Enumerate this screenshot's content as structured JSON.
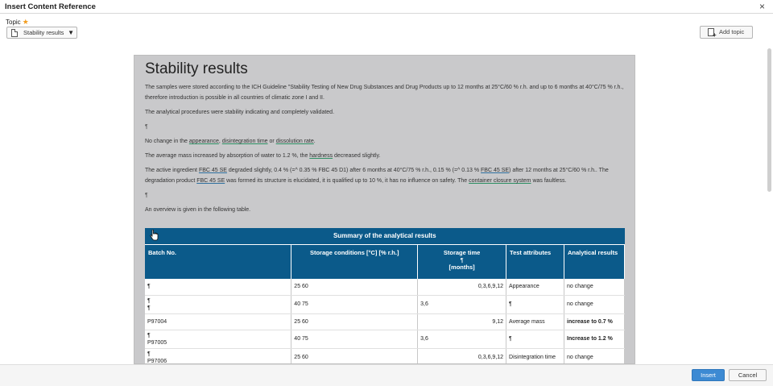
{
  "dialog": {
    "title": "Insert Content Reference",
    "close_glyph": "×"
  },
  "topic": {
    "label": "Topic",
    "required_mark": "★",
    "selected": "Stability results",
    "caret": "▼"
  },
  "add_topic_label": "Add topic",
  "document": {
    "title": "Stability results",
    "p1": "The samples were stored according to the ICH Guideline \"Stability Testing of New Drug Substances and Drug Products up to 12 months at 25°C/60 % r.h. and up to 6 months at 40°C/75 % r.h., therefore introduction is possible in all countries of climatic zone I and II.",
    "p2": "The analytical procedures were stability indicating and completely validated.",
    "pilcrow": "¶",
    "p3_pre": "No change in the ",
    "p3_l1": "appearance",
    "p3_sep1": ", ",
    "p3_l2": "disintegration time",
    "p3_sep2": " or ",
    "p3_l3": "dissolution rate",
    "p3_end": ".",
    "p4_pre": "The average mass increased by absorption of water to 1.2 %, the ",
    "p4_l1": "hardness",
    "p4_end": " decreased slightly.",
    "p5_a": "The active ingredient ",
    "p5_l1": "FBC 45 SE",
    "p5_b": " degraded slightly, 0.4 % (=^ 0.35 % FBC 45 D1) after 6 months at 40°C/75 % r.h., 0.15 % (=^ 0.13 % ",
    "p5_l2": "FBC 45 SE",
    "p5_c": ") after 12 months at 25°C/60 % r.h.. The degradation product ",
    "p5_l3": "FBC 45 SE",
    "p5_d": " was formed its structure is elucidated, it is qualified up to 10 %, it has no influence on safety. The ",
    "p5_l4": "container closure system",
    "p5_e": " was faultless.",
    "p6": "An overview is given in the following table."
  },
  "table": {
    "caption": "Summary of the analytical results",
    "headers": {
      "batch": "Batch No.",
      "storage": "Storage conditions [°C] [% r.h.]",
      "time": "Storage time",
      "time_mark": "¶",
      "time_unit": "[months]",
      "attr": "Test attributes",
      "result": "Analytical results"
    },
    "rows": [
      {
        "batch": "¶",
        "cond": "25 60",
        "time": "",
        "months": "0,3,6,9,12",
        "attr": "Appearance",
        "result": "no change"
      },
      {
        "batch": "¶\n¶",
        "cond": "40 75",
        "time": "3,6",
        "months": "",
        "attr": "¶",
        "result": "no change"
      },
      {
        "batch": "P97004",
        "cond": "25 60",
        "time": "",
        "months": "9,12",
        "attr": "Average mass",
        "result": "increase to 0.7 %"
      },
      {
        "batch": "¶\nP97005",
        "cond": "40 75",
        "time": "3,6",
        "months": "",
        "attr": "¶",
        "result": "Increase to 1.2 %"
      },
      {
        "batch": "¶\nP97006",
        "cond": "25 60",
        "time": "",
        "months": "0,3,6,9,12",
        "attr": "Disintegration time",
        "result": "no change"
      }
    ]
  },
  "footer": {
    "insert_label": "Insert",
    "cancel_label": "Cancel"
  },
  "colors": {
    "table_header": "#0b5a8a",
    "insert_button": "#3d8ad3",
    "required_star": "#f29d1f"
  }
}
